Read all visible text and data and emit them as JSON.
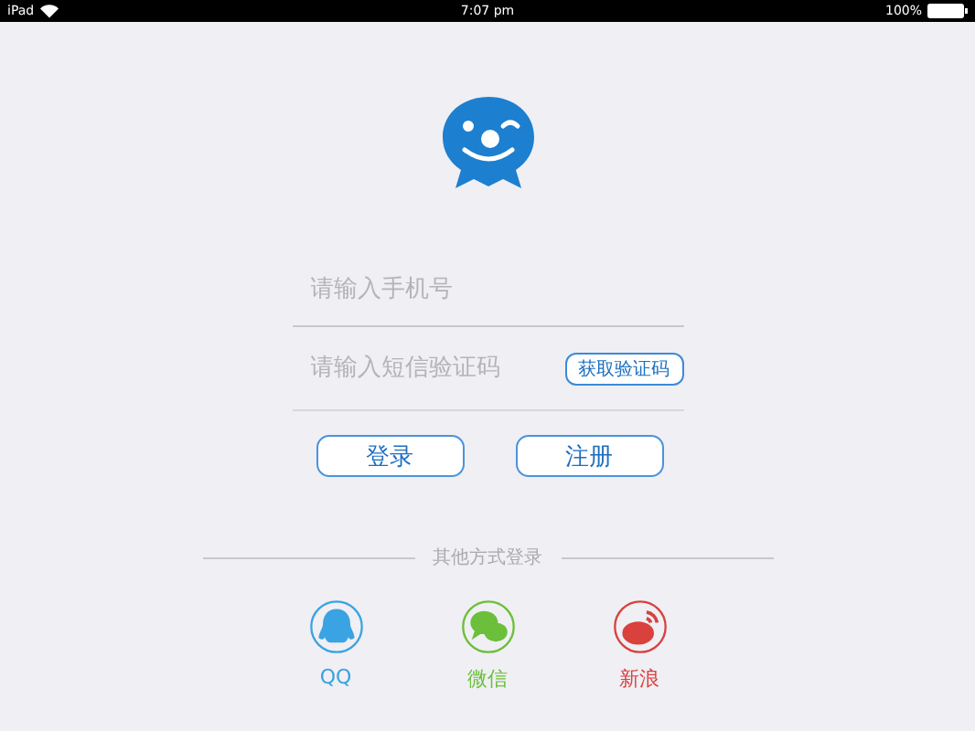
{
  "status_bar": {
    "device": "iPad",
    "time": "7:07 pm",
    "battery": "100%"
  },
  "phone_field": {
    "placeholder": "请输入手机号"
  },
  "code_field": {
    "placeholder": "请输入短信验证码"
  },
  "code_button": "获取验证码",
  "buttons": [
    "登录",
    "注册"
  ],
  "other_login": {
    "title": "其他方式登录",
    "items": [
      {
        "label": "QQ",
        "kind": "qq",
        "color": "#3aa3e3"
      },
      {
        "label": "微信",
        "kind": "wechat",
        "color": "#6cbf3a"
      },
      {
        "label": "新浪",
        "kind": "weibo",
        "color": "#d9413d"
      }
    ]
  }
}
